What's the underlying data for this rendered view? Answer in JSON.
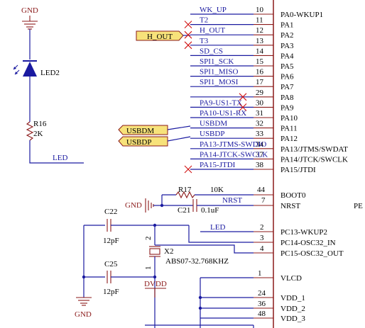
{
  "gnd_top": "GND",
  "led_ref": "LED2",
  "r16_ref": "R16",
  "r16_val": "2K",
  "led_net": "LED",
  "h_out_port": "H_OUT",
  "usbdm_port": "USBDM",
  "usbdp_port": "USBDP",
  "top_pins": [
    {
      "net": "WK_UP",
      "num": "10",
      "name": "PA0-WKUP1",
      "nc": false
    },
    {
      "net": "T2",
      "num": "11",
      "name": "PA1",
      "nc": true
    },
    {
      "net": "H_OUT",
      "num": "12",
      "name": "PA2",
      "nc": true
    },
    {
      "net": "T3",
      "num": "13",
      "name": "PA3",
      "nc": true
    },
    {
      "net": "SD_CS",
      "num": "14",
      "name": "PA4",
      "nc": false
    },
    {
      "net": "SPI1_SCK",
      "num": "15",
      "name": "PA5",
      "nc": false
    },
    {
      "net": "SPI1_MISO",
      "num": "16",
      "name": "PA6",
      "nc": false
    },
    {
      "net": "SPI1_MOSI",
      "num": "17",
      "name": "PA7",
      "nc": false
    },
    {
      "net": "",
      "num": "29",
      "name": "PA8",
      "nc": true
    },
    {
      "net": "PA9-US1-TX",
      "num": "30",
      "name": "PA9",
      "nc": true
    },
    {
      "net": "PA10-US1-RX",
      "num": "31",
      "name": "PA10",
      "nc": false
    },
    {
      "net": "USBDM",
      "num": "32",
      "name": "PA11",
      "nc": false
    },
    {
      "net": "USBDP",
      "num": "33",
      "name": "PA12",
      "nc": false
    },
    {
      "net": "PA13-JTMS-SWDIO",
      "num": "34",
      "name": "PA13/JTMS/SWDAT",
      "nc": false
    },
    {
      "net": "PA14-JTCK-SWCLK",
      "num": "37",
      "name": "PA14/JTCK/SWCLK",
      "nc": false
    },
    {
      "net": "PA15-JTDI",
      "num": "38",
      "name": "PA15/JTDI",
      "nc": true
    }
  ],
  "boot": {
    "num": "44",
    "name": "BOOT0"
  },
  "nrst": {
    "net": "NRST",
    "num": "7",
    "name": "NRST",
    "cut": "PE"
  },
  "r17_ref": "R17",
  "r17_val": "10K",
  "c21_ref": "C21",
  "c21_val": "0.1uF",
  "gnd_mid": "GND",
  "c22_ref": "C22",
  "c22_val": "12pF",
  "c25_ref": "C25",
  "c25_val": "12pF",
  "x2_ref": "X2",
  "x2_val": "ABS07-32.768KHZ",
  "x2_pin2": "2",
  "x2_pin1": "1",
  "gnd_bot": "GND",
  "dvdd": "DVDD",
  "pc_pins": [
    {
      "net": "LED",
      "num": "2",
      "name": "PC13-WKUP2"
    },
    {
      "net": "",
      "num": "3",
      "name": "PC14-OSC32_IN"
    },
    {
      "net": "",
      "num": "4",
      "name": "PC15-OSC32_OUT"
    }
  ],
  "pwr_pins": [
    {
      "num": "1",
      "name": "VLCD"
    },
    {
      "num": "24",
      "name": "VDD_1"
    },
    {
      "num": "36",
      "name": "VDD_2"
    },
    {
      "num": "48",
      "name": "VDD_3"
    }
  ]
}
